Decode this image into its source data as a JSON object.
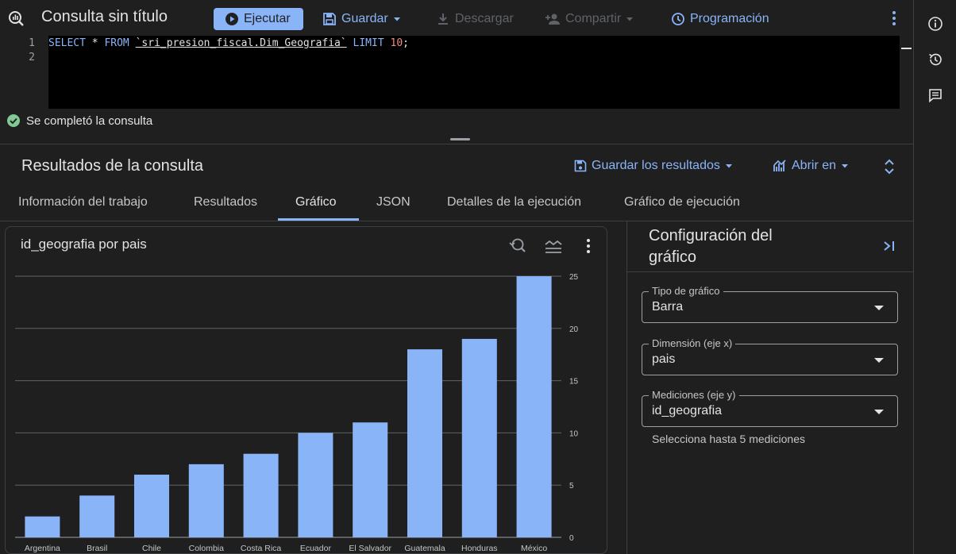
{
  "toolbar": {
    "query_title": "Consulta sin título",
    "run_label": "Ejecutar",
    "save_label": "Guardar",
    "download_label": "Descargar",
    "share_label": "Compartir",
    "schedule_label": "Programación"
  },
  "editor": {
    "line_numbers": [
      "1",
      "2"
    ],
    "sql_select": "SELECT",
    "sql_star": " * ",
    "sql_from": "FROM",
    "sql_table": "`sri_presion_fiscal.Dim_Geografia`",
    "sql_limit": "LIMIT",
    "sql_limit_value": "10",
    "sql_end": ";"
  },
  "status": {
    "text": "Se completó la consulta"
  },
  "results": {
    "title": "Resultados de la consulta",
    "save_results_label": "Guardar los resultados",
    "open_in_label": "Abrir en",
    "tabs": [
      {
        "label": "Información del trabajo"
      },
      {
        "label": "Resultados"
      },
      {
        "label": "Gráfico"
      },
      {
        "label": "JSON"
      },
      {
        "label": "Detalles de la ejecución"
      },
      {
        "label": "Gráfico de ejecución"
      }
    ],
    "active_tab": "Gráfico"
  },
  "chart_card": {
    "title": "id_geografia por pais"
  },
  "chart_data": {
    "type": "bar",
    "categories": [
      "Argentina",
      "Brasil",
      "Chile",
      "Colombia",
      "Costa Rica",
      "Ecuador",
      "El Salvador",
      "Guatemala",
      "Honduras",
      "México"
    ],
    "values": [
      2,
      4,
      6,
      7,
      8,
      10,
      11,
      18,
      19,
      25
    ],
    "y_ticks": [
      "0",
      "5",
      "10",
      "15",
      "20",
      "25"
    ],
    "ylim": [
      0,
      25
    ],
    "y_axis_side": "right",
    "grid": true,
    "bar_color": "#8ab4f8",
    "grid_color": "#5f6368"
  },
  "config": {
    "title": "Configuración del gráfico",
    "chart_type": {
      "label": "Tipo de gráfico",
      "value": "Barra"
    },
    "dimension": {
      "label": "Dimensión (eje x)",
      "value": "pais"
    },
    "measures": {
      "label": "Mediciones (eje y)",
      "value": "id_geografia"
    },
    "hint": "Selecciona hasta 5 mediciones"
  },
  "colors": {
    "accent": "#8ab4f8",
    "background": "#1f1f1f",
    "editor_background": "#000000",
    "success": "#81c995",
    "disabled": "#5f6368"
  },
  "icons": {
    "query": "query-icon",
    "run": "play-icon",
    "save": "save-icon",
    "download": "download-icon",
    "share": "person-add-icon",
    "schedule": "clock-icon",
    "more": "more-vert-icon",
    "info": "info-icon",
    "history": "history-icon",
    "comment": "comment-icon",
    "zoom": "zoom-reset-icon",
    "legend": "legend-icon",
    "collapse": "collapse-panel-icon",
    "expand": "unfold-icon",
    "dropdown": "caret-down-icon"
  }
}
